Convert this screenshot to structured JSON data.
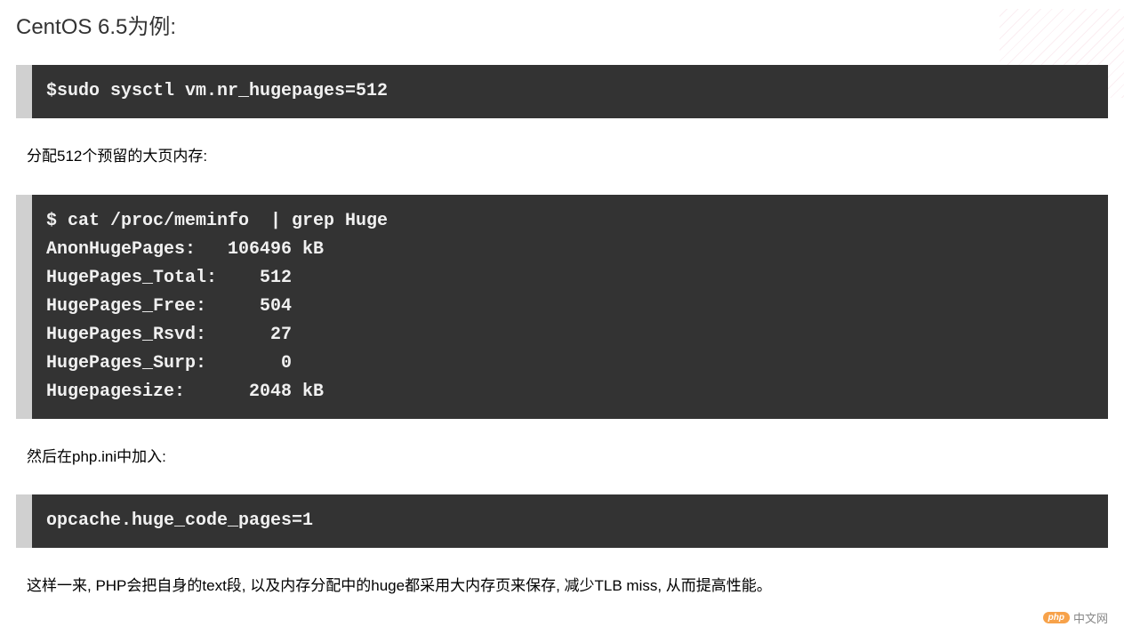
{
  "heading": "CentOS 6.5为例:",
  "code1": "$sudo sysctl vm.nr_hugepages=512",
  "para1": "分配512个预留的大页内存:",
  "code2": "$ cat /proc/meminfo  | grep Huge\nAnonHugePages:   106496 kB\nHugePages_Total:    512\nHugePages_Free:     504\nHugePages_Rsvd:      27\nHugePages_Surp:       0\nHugepagesize:      2048 kB",
  "para2": "然后在php.ini中加入:",
  "code3": "opcache.huge_code_pages=1",
  "para3": "这样一来, PHP会把自身的text段, 以及内存分配中的huge都采用大内存页来保存, 减少TLB miss, 从而提高性能。",
  "watermark": {
    "logo": "php",
    "text": "中文网"
  }
}
